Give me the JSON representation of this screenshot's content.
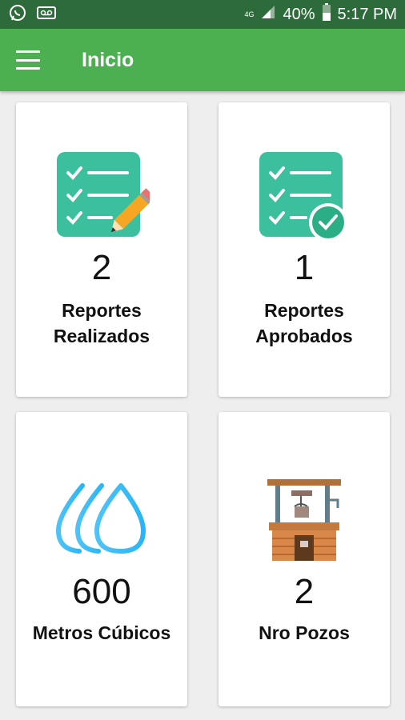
{
  "status_bar": {
    "network": "4G",
    "battery": "40%",
    "time": "5:17 PM"
  },
  "app_bar": {
    "title": "Inicio",
    "menu_icon": "hamburger-menu-icon"
  },
  "cards": [
    {
      "icon": "checklist-pencil-icon",
      "value": "2",
      "label_line1": "Reportes",
      "label_line2": "Realizados"
    },
    {
      "icon": "checklist-check-icon",
      "value": "1",
      "label_line1": "Reportes",
      "label_line2": "Aprobados"
    },
    {
      "icon": "water-drops-icon",
      "value": "600",
      "label_line1": "Metros Cúbicos"
    },
    {
      "icon": "water-well-icon",
      "value": "2",
      "label_line1": "Nro Pozos"
    }
  ],
  "colors": {
    "status_bar": "#2e6b3a",
    "app_bar": "#4caf50",
    "checklist_teal": "#3cbf9c",
    "water_blue": "#29b6f6"
  }
}
